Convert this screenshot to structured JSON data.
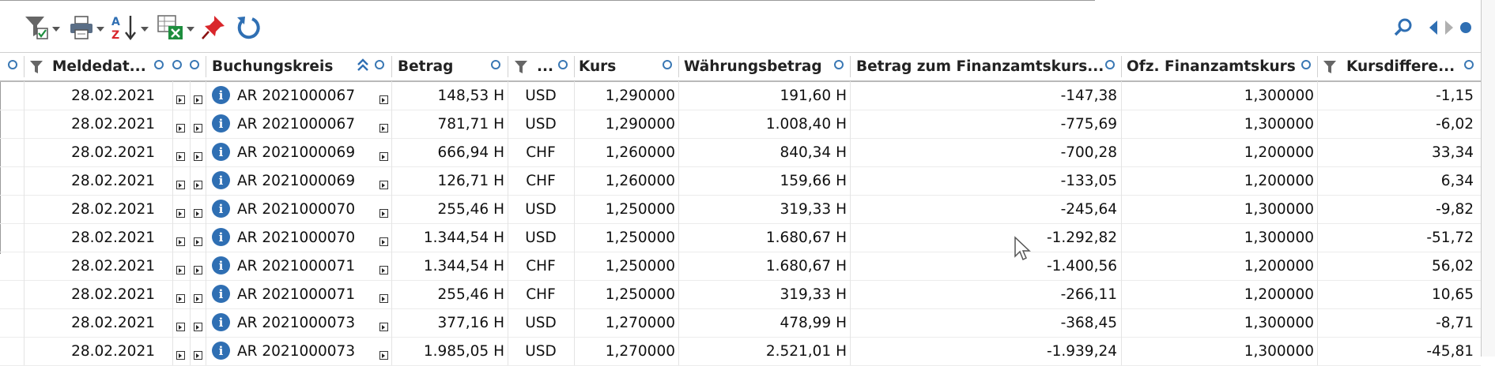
{
  "toolbar": {
    "left_icons": [
      "filter-checklist-icon",
      "print-icon",
      "sort-az-icon",
      "excel-export-icon",
      "pin-icon",
      "refresh-icon"
    ],
    "right_icons": [
      "search-icon",
      "prev-arrow-icon",
      "next-arrow-icon",
      "dot-icon"
    ]
  },
  "colors": {
    "accent": "#2f6fb3",
    "pin": "#d9262b",
    "excel": "#1e8e3e",
    "header_icon": "#3a78b4"
  },
  "columns": {
    "meldedatum": "Meldedat...",
    "buchungskreis": "Buchungskreis",
    "betrag": "Betrag",
    "currency": "...",
    "kurs": "Kurs",
    "waehrungsbetrag": "Währungsbetrag",
    "betrag_fa": "Betrag zum Finanzamtskurs...",
    "ofz_kurs": "Ofz. Finanzamtskurs",
    "kursdifferenz": "Kursdiffere..."
  },
  "rows": [
    {
      "date": "28.02.2021",
      "doc": "AR 2021000067",
      "betrag": "148,53 H",
      "cur": "USD",
      "kurs": "1,290000",
      "wbetrag": "191,60 H",
      "fabetrag": "-147,38",
      "ofz": "1,300000",
      "diff": "-1,15"
    },
    {
      "date": "28.02.2021",
      "doc": "AR 2021000067",
      "betrag": "781,71 H",
      "cur": "USD",
      "kurs": "1,290000",
      "wbetrag": "1.008,40 H",
      "fabetrag": "-775,69",
      "ofz": "1,300000",
      "diff": "-6,02"
    },
    {
      "date": "28.02.2021",
      "doc": "AR 2021000069",
      "betrag": "666,94 H",
      "cur": "CHF",
      "kurs": "1,260000",
      "wbetrag": "840,34 H",
      "fabetrag": "-700,28",
      "ofz": "1,200000",
      "diff": "33,34"
    },
    {
      "date": "28.02.2021",
      "doc": "AR 2021000069",
      "betrag": "126,71 H",
      "cur": "CHF",
      "kurs": "1,260000",
      "wbetrag": "159,66 H",
      "fabetrag": "-133,05",
      "ofz": "1,200000",
      "diff": "6,34"
    },
    {
      "date": "28.02.2021",
      "doc": "AR 2021000070",
      "betrag": "255,46 H",
      "cur": "USD",
      "kurs": "1,250000",
      "wbetrag": "319,33 H",
      "fabetrag": "-245,64",
      "ofz": "1,300000",
      "diff": "-9,82"
    },
    {
      "date": "28.02.2021",
      "doc": "AR 2021000070",
      "betrag": "1.344,54 H",
      "cur": "USD",
      "kurs": "1,250000",
      "wbetrag": "1.680,67 H",
      "fabetrag": "-1.292,82",
      "ofz": "1,300000",
      "diff": "-51,72"
    },
    {
      "date": "28.02.2021",
      "doc": "AR 2021000071",
      "betrag": "1.344,54 H",
      "cur": "CHF",
      "kurs": "1,250000",
      "wbetrag": "1.680,67 H",
      "fabetrag": "-1.400,56",
      "ofz": "1,200000",
      "diff": "56,02"
    },
    {
      "date": "28.02.2021",
      "doc": "AR 2021000071",
      "betrag": "255,46 H",
      "cur": "CHF",
      "kurs": "1,250000",
      "wbetrag": "319,33 H",
      "fabetrag": "-266,11",
      "ofz": "1,200000",
      "diff": "10,65"
    },
    {
      "date": "28.02.2021",
      "doc": "AR 2021000073",
      "betrag": "377,16 H",
      "cur": "USD",
      "kurs": "1,270000",
      "wbetrag": "478,99 H",
      "fabetrag": "-368,45",
      "ofz": "1,300000",
      "diff": "-8,71"
    },
    {
      "date": "28.02.2021",
      "doc": "AR 2021000073",
      "betrag": "1.985,05 H",
      "cur": "USD",
      "kurs": "1,270000",
      "wbetrag": "2.521,01 H",
      "fabetrag": "-1.939,24",
      "ofz": "1,300000",
      "diff": "-45,81"
    }
  ]
}
